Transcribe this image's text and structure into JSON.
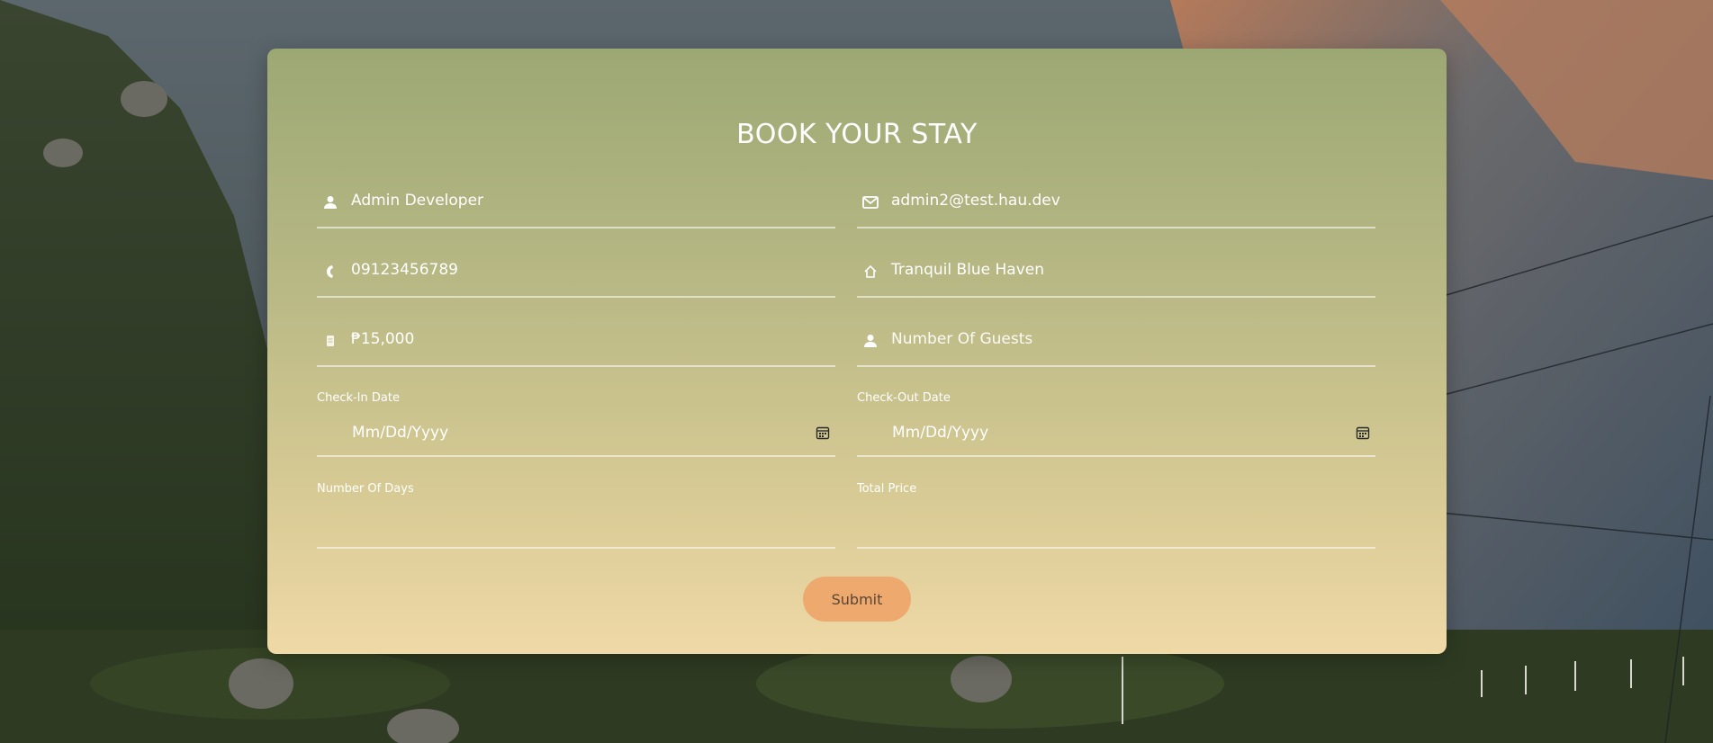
{
  "form": {
    "title": "BOOK YOUR STAY",
    "name": {
      "icon": "person-icon",
      "value": "Admin Developer"
    },
    "email": {
      "icon": "envelope-icon",
      "value": "admin2@test.hau.dev"
    },
    "phone": {
      "icon": "phone-icon",
      "value": "09123456789"
    },
    "room": {
      "icon": "home-icon",
      "value": "Tranquil Blue Haven"
    },
    "price": {
      "icon": "money-icon",
      "value": "₱15,000"
    },
    "guests": {
      "icon": "person-icon",
      "placeholder": "Number Of Guests"
    },
    "check_in": {
      "label": "Check-In Date",
      "placeholder": "Mm/Dd/Yyyy",
      "icon": "calendar-icon"
    },
    "check_out": {
      "label": "Check-Out Date",
      "placeholder": "Mm/Dd/Yyyy",
      "icon": "calendar-icon"
    },
    "number_of_days": {
      "label": "Number Of Days",
      "value": ""
    },
    "total_price": {
      "label": "Total Price",
      "value": ""
    },
    "submit_label": "Submit"
  },
  "colors": {
    "card_top": "#9ca874",
    "card_bottom": "#efd9a7",
    "submit_button": "#eeaa6e",
    "text": "#ffffff"
  }
}
